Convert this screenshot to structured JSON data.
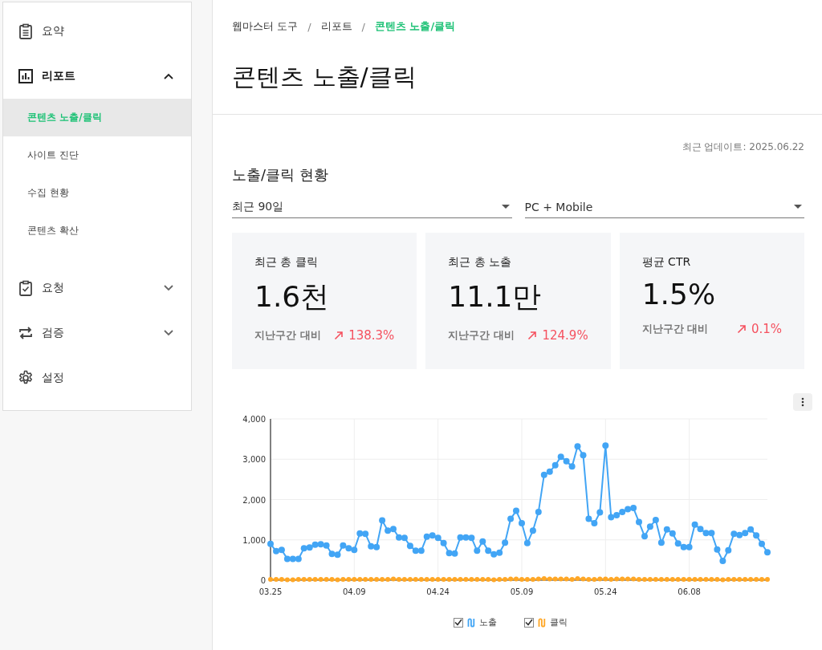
{
  "sidebar": {
    "items": [
      {
        "label": "요약"
      },
      {
        "label": "리포트",
        "expanded": true,
        "children": [
          {
            "label": "콘텐츠 노출/클릭",
            "selected": true
          },
          {
            "label": "사이트 진단",
            "selected": false
          },
          {
            "label": "수집 현황",
            "selected": false
          },
          {
            "label": "콘텐츠 확산",
            "selected": false
          }
        ]
      },
      {
        "label": "요청",
        "expanded": false
      },
      {
        "label": "검증",
        "expanded": false
      },
      {
        "label": "설정"
      }
    ]
  },
  "breadcrumb": [
    {
      "label": "웹마스터 도구",
      "selected": false
    },
    {
      "label": "리포트",
      "selected": false
    },
    {
      "label": "콘텐츠 노출/클릭",
      "selected": true
    }
  ],
  "breadcrumb_separator": "/",
  "page_title": "콘텐츠 노출/클릭",
  "last_updated": "최근 업데이트: 2025.06.22",
  "section_title": "노출/클릭 현황",
  "filters": [
    {
      "value": "최근 90일"
    },
    {
      "value": "PC + Mobile"
    }
  ],
  "cards": [
    {
      "label": "최근 총 클릭",
      "value": "1.6천",
      "compare_label": "지난구간 대비",
      "change": "138.3%"
    },
    {
      "label": "최근 총 노출",
      "value": "11.1만",
      "compare_label": "지난구간 대비",
      "change": "124.9%"
    },
    {
      "label": "평균 CTR",
      "value": "1.5%",
      "compare_label": "지난구간 대비",
      "change": "0.1%"
    }
  ],
  "chart": {
    "legend": [
      {
        "checked": true
      },
      {
        "checked": true
      }
    ],
    "chart_data": {
      "type": "line",
      "grid": true,
      "categories": [
        "03.25",
        null,
        null,
        null,
        null,
        null,
        null,
        null,
        null,
        null,
        null,
        null,
        null,
        null,
        null,
        "04.09",
        null,
        null,
        null,
        null,
        null,
        null,
        null,
        null,
        null,
        null,
        null,
        null,
        null,
        null,
        "04.24",
        null,
        null,
        null,
        null,
        null,
        null,
        null,
        null,
        null,
        null,
        null,
        null,
        null,
        null,
        "05.09",
        null,
        null,
        null,
        null,
        null,
        null,
        null,
        null,
        null,
        null,
        null,
        null,
        null,
        null,
        "05.24",
        null,
        null,
        null,
        null,
        null,
        null,
        null,
        null,
        null,
        null,
        null,
        null,
        null,
        null,
        "06.08",
        null,
        null,
        null,
        null,
        null,
        null,
        null,
        null,
        null,
        null,
        null,
        null,
        null,
        null
      ],
      "series": [
        {
          "name": "노출",
          "color": "#42a5f5",
          "marker": "circle",
          "values": [
            900,
            720,
            750,
            530,
            530,
            530,
            790,
            810,
            880,
            890,
            860,
            650,
            630,
            860,
            790,
            750,
            1160,
            1150,
            840,
            820,
            1480,
            1230,
            1270,
            1060,
            1050,
            850,
            730,
            730,
            1080,
            1110,
            1050,
            920,
            670,
            660,
            1060,
            1060,
            1050,
            730,
            960,
            730,
            640,
            680,
            930,
            1520,
            1720,
            1410,
            920,
            1230,
            1690,
            2610,
            2690,
            2850,
            3060,
            2950,
            2820,
            3320,
            3100,
            1520,
            1410,
            1680,
            3340,
            1560,
            1610,
            1690,
            1760,
            1790,
            1440,
            1090,
            1330,
            1490,
            930,
            1260,
            1160,
            910,
            820,
            820,
            1380,
            1270,
            1170,
            1170,
            760,
            480,
            740,
            1150,
            1120,
            1170,
            1260,
            1110,
            900,
            690
          ]
        },
        {
          "name": "클릭",
          "color": "#ffa726",
          "marker": "circle",
          "values": [
            20,
            20,
            20,
            10,
            10,
            20,
            20,
            20,
            20,
            20,
            20,
            20,
            10,
            20,
            20,
            20,
            20,
            20,
            20,
            20,
            20,
            20,
            30,
            20,
            20,
            20,
            20,
            20,
            20,
            20,
            20,
            20,
            20,
            20,
            20,
            20,
            20,
            20,
            20,
            20,
            10,
            20,
            20,
            30,
            30,
            20,
            20,
            20,
            30,
            40,
            30,
            30,
            30,
            30,
            20,
            40,
            30,
            20,
            20,
            30,
            30,
            20,
            30,
            30,
            30,
            30,
            20,
            20,
            20,
            20,
            20,
            20,
            20,
            20,
            20,
            20,
            20,
            20,
            20,
            20,
            20,
            10,
            20,
            20,
            20,
            20,
            20,
            20,
            20,
            20
          ]
        }
      ],
      "ylim": [
        0,
        4000
      ],
      "yticks": [
        0,
        {
          "value": 1000,
          "label": "1,000"
        },
        {
          "value": 2000,
          "label": "2,000"
        },
        {
          "value": 3000,
          "label": "3,000"
        },
        {
          "value": 4000,
          "label": "4,000"
        }
      ]
    }
  }
}
